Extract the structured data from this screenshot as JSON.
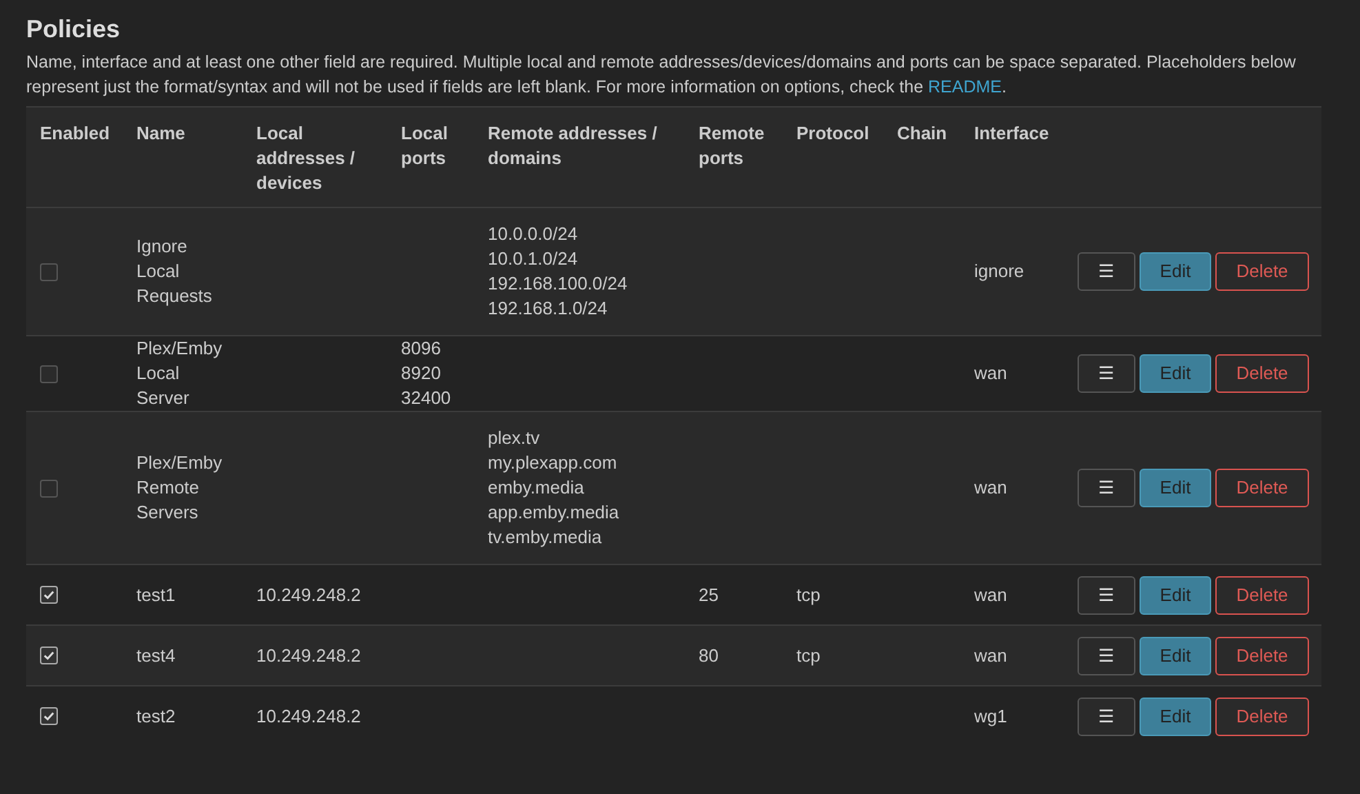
{
  "title": "Policies",
  "description": {
    "text": "Name, interface and at least one other field are required. Multiple local and remote addresses/devices/domains and ports can be space separated. Placeholders below represent just the format/syntax and will not be used if fields are left blank. For more information on options, check the ",
    "link": "README",
    "end": "."
  },
  "table": {
    "columns": [
      "Enabled",
      "Name",
      "Local addresses / devices",
      "Local ports",
      "Remote addresses / domains",
      "Remote ports",
      "Protocol",
      "Chain",
      "Interface"
    ],
    "rows": [
      {
        "enabled": false,
        "name": "Ignore Local Requests",
        "local_addresses": [],
        "local_ports": [],
        "remote_addresses": [
          "10.0.0.0/24",
          "10.0.1.0/24",
          "192.168.100.0/24",
          "192.168.1.0/24"
        ],
        "remote_ports": "",
        "protocol": "",
        "interface": "ignore",
        "buttons": [
          "☰",
          "Edit",
          "Delete"
        ]
      },
      {
        "enabled": false,
        "name": "Plex/Emby Local Server",
        "local_addresses": [],
        "local_ports": [
          "8096",
          "8920",
          "32400"
        ],
        "remote_addresses": [],
        "remote_ports": "",
        "protocol": "",
        "interface": "wan",
        "buttons": [
          "☰",
          "Edit",
          "Delete"
        ]
      },
      {
        "enabled": false,
        "name": "Plex/Emby Remote Servers",
        "local_addresses": [],
        "local_ports": [],
        "remote_addresses": [
          "plex.tv",
          "my.plexapp.com",
          "emby.media",
          "app.emby.media",
          "tv.emby.media"
        ],
        "remote_ports": "",
        "protocol": "",
        "interface": "wan",
        "buttons": [
          "☰",
          "Edit",
          "Delete"
        ]
      },
      {
        "enabled": true,
        "name": "test1",
        "local_addresses": [
          "10.249.248.2"
        ],
        "local_ports": [],
        "remote_addresses": [],
        "remote_ports": "25",
        "protocol": "tcp",
        "interface": "wan",
        "buttons": [
          "☰",
          "Edit",
          "Delete"
        ]
      },
      {
        "enabled": true,
        "name": "test4",
        "local_addresses": [
          "10.249.248.2"
        ],
        "local_ports": [],
        "remote_addresses": [],
        "remote_ports": "80",
        "protocol": "tcp",
        "interface": "wan",
        "buttons": [
          "☰",
          "Edit",
          "Delete"
        ]
      },
      {
        "enabled": true,
        "name": "test2",
        "local_addresses": [
          "10.249.248.2"
        ],
        "local_ports": [],
        "remote_addresses": [],
        "remote_ports": "",
        "protocol": "",
        "interface": "wg1",
        "buttons": [
          "☰",
          "Edit",
          "Delete"
        ]
      }
    ]
  }
}
